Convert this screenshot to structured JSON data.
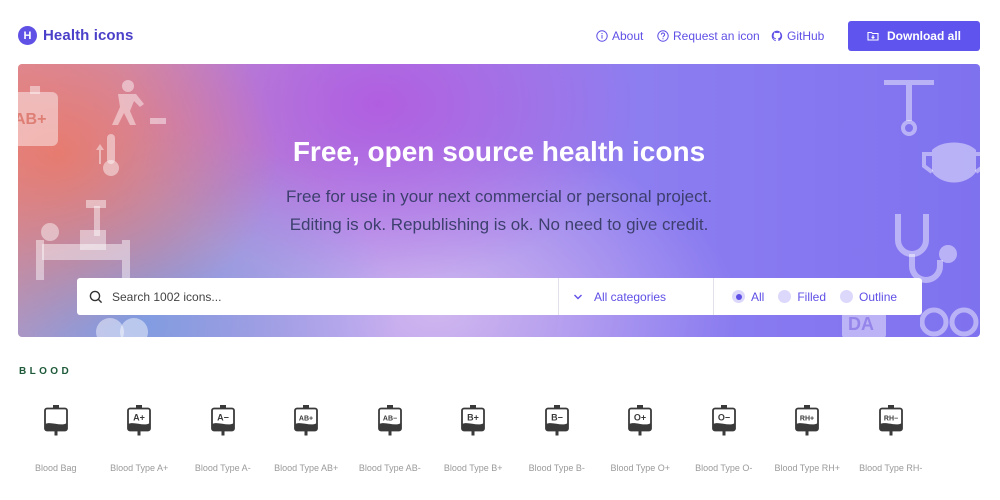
{
  "header": {
    "logo_letter": "H",
    "brand": "Health icons",
    "nav": {
      "about": "About",
      "request": "Request an icon",
      "github": "GitHub"
    },
    "download_label": "Download all"
  },
  "hero": {
    "title": "Free, open source health icons",
    "line1": "Free for use in your next commercial or personal project.",
    "line2": "Editing is ok. Republishing is ok. No need to give credit.",
    "deco_text_ab": "AB+",
    "deco_text_da": "DA"
  },
  "search": {
    "placeholder": "Search 1002 icons...",
    "category_label": "All categories",
    "styles": [
      {
        "label": "All",
        "selected": true
      },
      {
        "label": "Filled",
        "selected": false
      },
      {
        "label": "Outline",
        "selected": false
      }
    ]
  },
  "section": {
    "title": "BLOOD",
    "icons": [
      {
        "label": "Blood Bag",
        "code": ""
      },
      {
        "label": "Blood Type A+",
        "code": "A+"
      },
      {
        "label": "Blood Type A-",
        "code": "A−"
      },
      {
        "label": "Blood Type AB+",
        "code": "AB+"
      },
      {
        "label": "Blood Type AB-",
        "code": "AB−"
      },
      {
        "label": "Blood Type B+",
        "code": "B+"
      },
      {
        "label": "Blood Type B-",
        "code": "B−"
      },
      {
        "label": "Blood Type O+",
        "code": "O+"
      },
      {
        "label": "Blood Type O-",
        "code": "O−"
      },
      {
        "label": "Blood Type RH+",
        "code": "RH+"
      },
      {
        "label": "Blood Type RH-",
        "code": "RH−"
      }
    ]
  },
  "colors": {
    "brand": "#5f50e6",
    "section_title": "#1e5a3a",
    "icon": "#3a3a3a"
  }
}
